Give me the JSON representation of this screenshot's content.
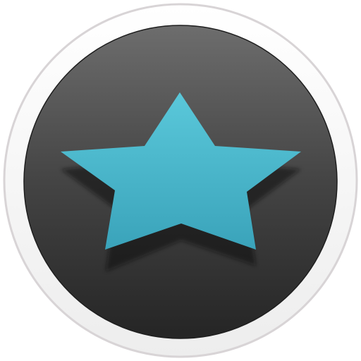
{
  "app_icon": {
    "icon_name": "star-icon",
    "colors": {
      "background": "#ffffff",
      "outer_ring": "#ededed",
      "ring_edge": "#d8d4d6",
      "inner_disc_top": "#6d6d6d",
      "inner_disc_bottom": "#252525",
      "star_top": "#5ac8da",
      "star_bottom": "#3aa3ba",
      "shadow": "#111111"
    }
  }
}
